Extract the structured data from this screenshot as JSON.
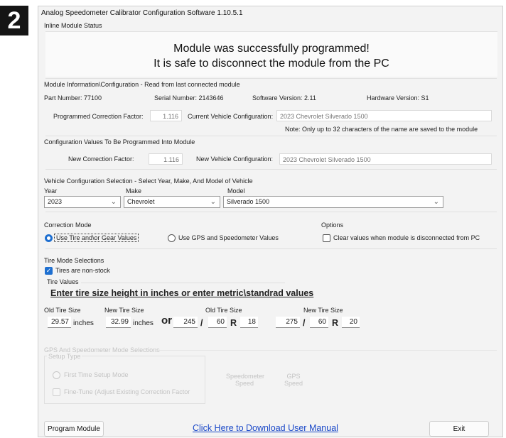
{
  "step_badge": "2",
  "window": {
    "title": "Analog Speedometer Calibrator Configuration Software 1.10.5.1"
  },
  "status": {
    "group_label": "Inline Module Status",
    "line1": "Module was successfully programmed!",
    "line2": "It is safe to disconnect the module from the PC"
  },
  "module_info": {
    "group_label": "Module Information\\Configuration - Read from last connected module",
    "part_number": "Part Number: 77100",
    "serial_number": "Serial Number: 2143646",
    "software_version": "Software Version: 2.11",
    "hardware_version": "Hardware Version: S1",
    "prog_cf_label": "Programmed Correction Factor:",
    "prog_cf_value": "1.116",
    "current_config_label": "Current Vehicle Configuration:",
    "current_config_value": "2023 Chevrolet Silverado 1500",
    "note": "Note: Only up to 32 characters of the name are saved to the module"
  },
  "config_values": {
    "group_label": "Configuration Values To Be Programmed Into Module",
    "new_cf_label": "New Correction Factor:",
    "new_cf_value": "1.116",
    "new_config_label": "New Vehicle Configuration:",
    "new_config_value": "2023 Chevrolet Silverado 1500"
  },
  "vehicle_selection": {
    "group_label": "Vehicle Configuration Selection - Select Year, Make, And Model of Vehicle",
    "year_label": "Year",
    "year_value": "2023",
    "make_label": "Make",
    "make_value": "Chevrolet",
    "model_label": "Model",
    "model_value": "Silverado 1500"
  },
  "correction_mode": {
    "group_label": "Correction Mode",
    "option_tire": "Use Tire and\\or Gear Values",
    "option_gps": "Use GPS and Speedometer Values",
    "selected": "tire"
  },
  "options": {
    "group_label": "Options",
    "clear_values_label": "Clear values when module is disconnected from PC",
    "clear_values_checked": false
  },
  "tire_mode": {
    "group_label": "Tire Mode Selections",
    "non_stock_label": "Tires are non-stock",
    "non_stock_checked": true,
    "tire_values_label": "Tire Values",
    "instruction": "Enter tire size height in inches or enter metric\\standrad values",
    "old_tire_label": "Old Tire Size",
    "new_tire_label": "New Tire Size",
    "old_tire_inches": "29.57",
    "new_tire_inches": "32.99",
    "inches_unit": "inches",
    "or_text": "or",
    "metric_old_label": "Old Tire Size",
    "metric_new_label": "New Tire Size",
    "old_width": "245",
    "old_aspect": "60",
    "old_rim": "18",
    "new_width": "275",
    "new_aspect": "60",
    "new_rim": "20",
    "slash": "/",
    "r_letter": "R"
  },
  "gps_mode": {
    "group_label": "GPS And Speedometer Mode Selections",
    "setup_type_label": "Setup Type",
    "first_time_label": "First Time Setup Mode",
    "fine_tune_label": "Fine-Tune (Adjust Existing Correction Factor",
    "speedometer_speed_label": "Speedometer Speed",
    "gps_speed_label": "GPS Speed"
  },
  "footer": {
    "program_button": "Program Module",
    "download_link": "Click Here to Download User Manual",
    "exit_button": "Exit",
    "link_color": "#1a48c8"
  }
}
